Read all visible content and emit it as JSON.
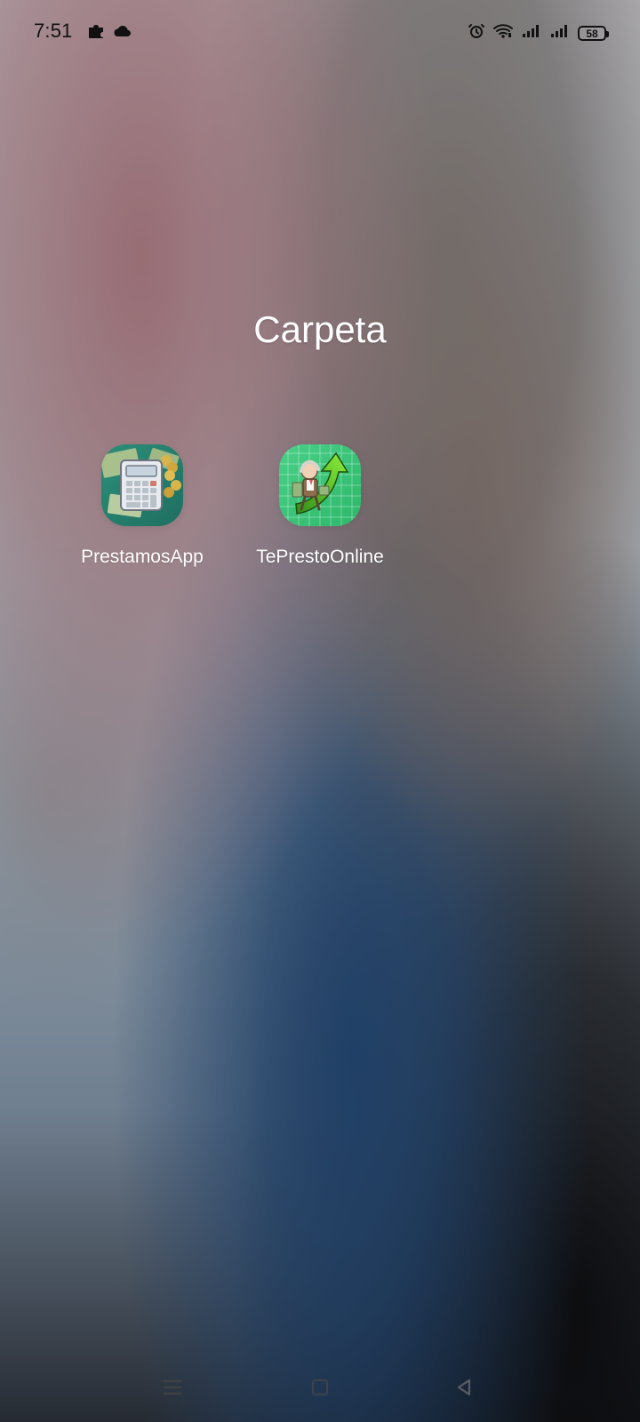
{
  "status_bar": {
    "time": "7:51",
    "left_icons": [
      "puzzle-icon",
      "cloud-icon"
    ],
    "right_icons": [
      "alarm-icon",
      "wifi-icon",
      "signal-icon",
      "signal-icon"
    ],
    "battery": "58"
  },
  "folder": {
    "title": "Carpeta",
    "apps": [
      {
        "label": "PrestamosApp",
        "icon": "calculator-money-icon"
      },
      {
        "label": "TePrestoOnline",
        "icon": "growth-arrow-icon"
      }
    ]
  },
  "navigation": {
    "items": [
      "menu-icon",
      "home-icon",
      "back-icon"
    ]
  }
}
